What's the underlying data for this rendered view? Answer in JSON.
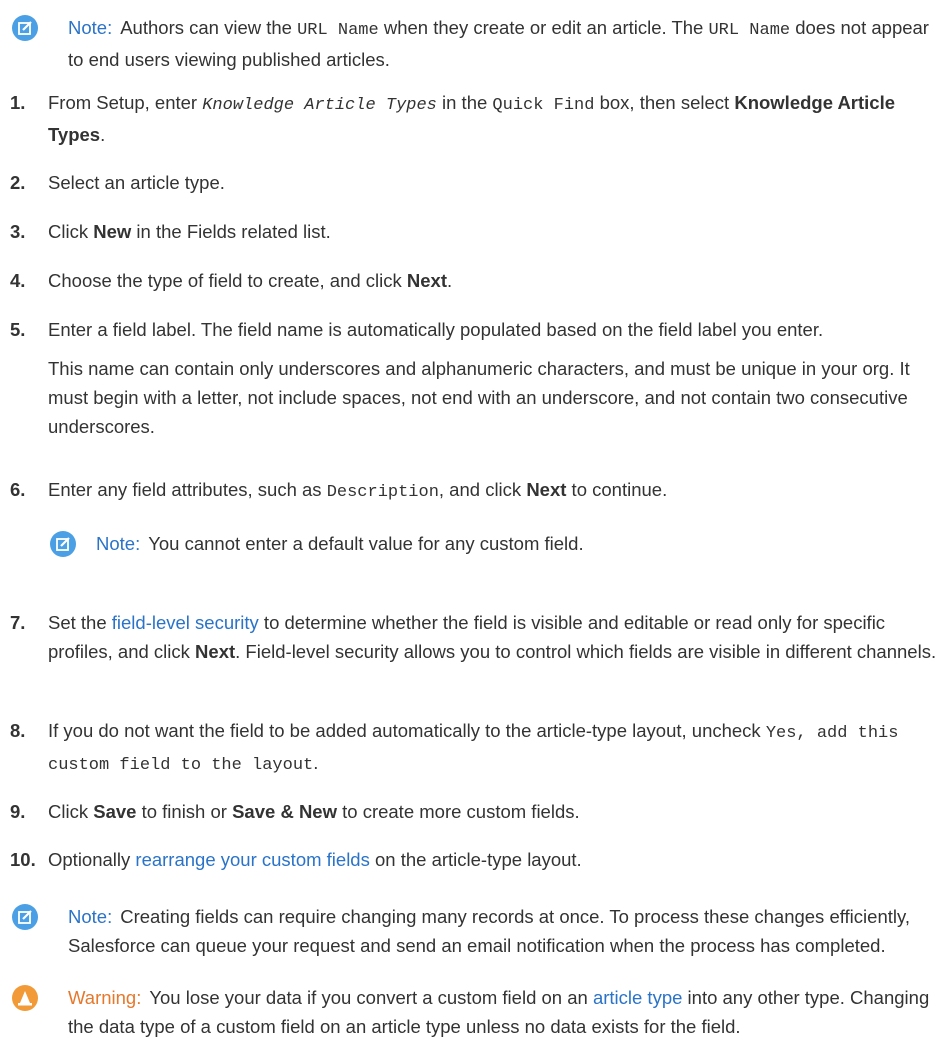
{
  "note_top": {
    "label": "Note:",
    "t1": "Authors can view the ",
    "c1": "URL Name",
    "t2": " when they create or edit an article. The ",
    "c2": "URL Name",
    "t3": " does not appear to end users viewing published articles."
  },
  "steps": [
    {
      "num": "1.",
      "t1": "From Setup, enter ",
      "c1": "Knowledge Article Types",
      "t2": " in the ",
      "c2": "Quick Find",
      "t3": " box, then select ",
      "b1": "Knowledge Article Types",
      "t4": "."
    },
    {
      "num": "2.",
      "text": "Select an article type."
    },
    {
      "num": "3.",
      "t1": "Click ",
      "b1": "New",
      "t2": " in the Fields related list."
    },
    {
      "num": "4.",
      "t1": "Choose the type of field to create, and click ",
      "b1": "Next",
      "t2": "."
    },
    {
      "num": "5.",
      "text": "Enter a field label. The field name is automatically populated based on the field label you enter.",
      "text2": "This name can contain only underscores and alphanumeric characters, and must be unique in your org. It must begin with a letter, not include spaces, not end with an underscore, and not contain two consecutive underscores."
    },
    {
      "num": "6.",
      "t1": "Enter any field attributes, such as ",
      "c1": "Description",
      "t2": ", and click ",
      "b1": "Next",
      "t3": " to continue."
    },
    {
      "num": "7.",
      "t1": "Set the ",
      "link": "field-level security",
      "t2": " to determine whether the field is visible and editable or read only for specific profiles, and click ",
      "b1": "Next",
      "t3": ". Field-level security allows you to control which fields are visible in different channels."
    },
    {
      "num": "8.",
      "t1": "If you do not want the field to be added automatically to the article-type layout, uncheck ",
      "c1": "Yes, add this custom field to the layout",
      "t2": "."
    },
    {
      "num": "9.",
      "t1": "Click ",
      "b1": "Save",
      "t2": " to finish or ",
      "b2": "Save & New",
      "t3": " to create more custom fields."
    },
    {
      "num": "10.",
      "t1": "Optionally ",
      "link": "rearrange your custom fields",
      "t2": " on the article-type layout."
    }
  ],
  "note_step6": {
    "label": "Note:",
    "text": "You cannot enter a default value for any custom field."
  },
  "note_bottom": {
    "label": "Note:",
    "text": "Creating fields can require changing many records at once. To process these changes efficiently, Salesforce can queue your request and send an email notification when the process has completed."
  },
  "warning": {
    "label": "Warning:",
    "t1": "You lose your data if you convert a custom field on an ",
    "link": "article type",
    "t2": " into any other type. Changing the data type of a custom field on an article type unless no data exists for the field."
  },
  "colors": {
    "note_icon": "#4b9fe4",
    "warning_icon": "#f29a38",
    "link": "#2a73c8",
    "label": "#2a73c8",
    "warning_label": "#e6782c"
  },
  "icons": {
    "note": "note-edit-icon",
    "warning": "warning-cone-icon"
  }
}
